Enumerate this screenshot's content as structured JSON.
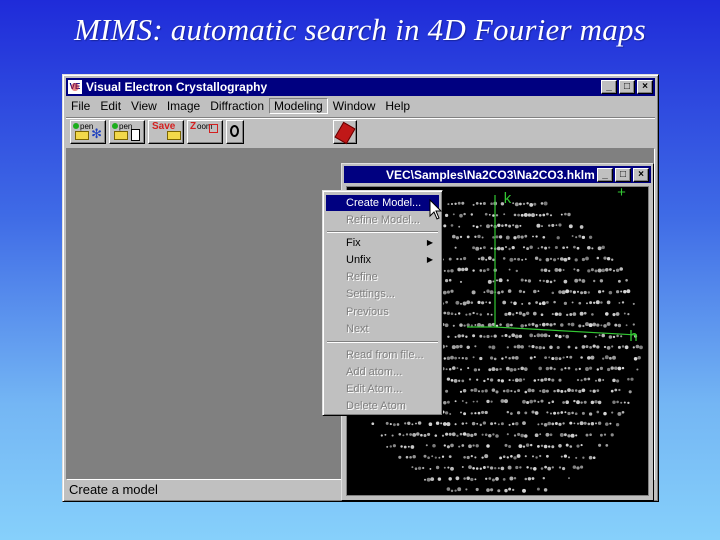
{
  "slide": {
    "title": "MIMS: automatic search in 4D Fourier maps"
  },
  "app": {
    "title": "Visual Electron Crystallography",
    "icon_label": "VE",
    "window_buttons": [
      "_",
      "□",
      "×"
    ],
    "menu": [
      "File",
      "Edit",
      "View",
      "Image",
      "Diffraction",
      "Modeling",
      "Window",
      "Help"
    ],
    "active_menu": "Modeling",
    "toolbar": {
      "open1_label": "pen",
      "open2_label": "pen",
      "save_label": "Save",
      "zoom_label": "oom",
      "icons": [
        "open-file-icon",
        "open-diffraction-icon",
        "save-icon",
        "zoom-icon",
        "magnifier-icon",
        "book-icon"
      ]
    },
    "status": "Create a model"
  },
  "modeling_menu": {
    "items": [
      {
        "label": "Create Model...",
        "state": "selected"
      },
      {
        "label": "Refine Model...",
        "state": "disabled"
      },
      {
        "label": "Fix",
        "state": "enabled",
        "submenu": true
      },
      {
        "label": "Unfix",
        "state": "enabled",
        "submenu": true
      },
      {
        "label": "Refine",
        "state": "disabled"
      },
      {
        "label": "Settings...",
        "state": "disabled"
      },
      {
        "label": "Previous",
        "state": "disabled"
      },
      {
        "label": "Next",
        "state": "disabled"
      },
      {
        "label": "Read from file...",
        "state": "disabled"
      },
      {
        "label": "Add atom...",
        "state": "disabled"
      },
      {
        "label": "Edit Atom...",
        "state": "disabled"
      },
      {
        "label": "Delete Atom",
        "state": "disabled"
      }
    ]
  },
  "child_window": {
    "title": "VEC\\Samples\\Na2CO3\\Na2CO3.hklm",
    "axis_k": "k",
    "axis_h": "h",
    "plus": "+",
    "colors": {
      "axis": "#33c733",
      "spot": "#d9d9d9",
      "background": "#000000"
    }
  }
}
